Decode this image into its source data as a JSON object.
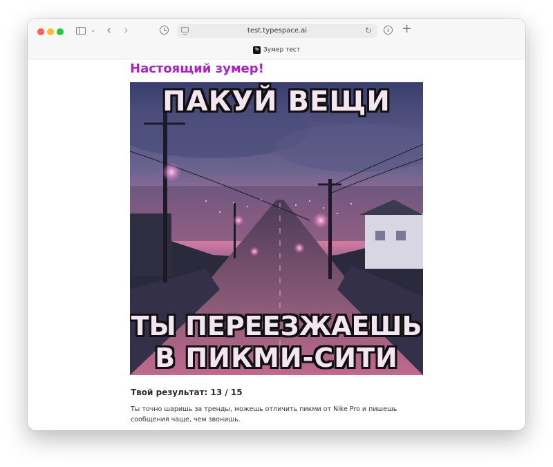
{
  "browser": {
    "url": "test.typespace.ai",
    "tab_title": "Зумер тест",
    "favicon_text": "Ts",
    "icons": {
      "sidebar": "sidebar-icon",
      "tab_overview": "chevron-down-icon",
      "back": "chevron-left-icon",
      "forward": "chevron-right-icon",
      "history": "clock-icon",
      "page": "page-icon",
      "reload": "reload-icon",
      "download": "download-icon",
      "new_tab": "plus-icon"
    }
  },
  "page": {
    "title": "Настоящий зумер!",
    "title_color": "#a626c4",
    "meme": {
      "top_text": "ПАКУЙ ВЕЩИ",
      "bottom_line1": "ТЫ ПЕРЕЕЗЖАЕШЬ",
      "bottom_line2": "В ПИКМИ-СИТИ"
    },
    "score_label": "Твой результат: 13 / 15",
    "description": "Ты точно шаришь за тренды, можешь отличить пикми от Nike Pro и пишешь сообщения чаще, чем звонишь."
  }
}
